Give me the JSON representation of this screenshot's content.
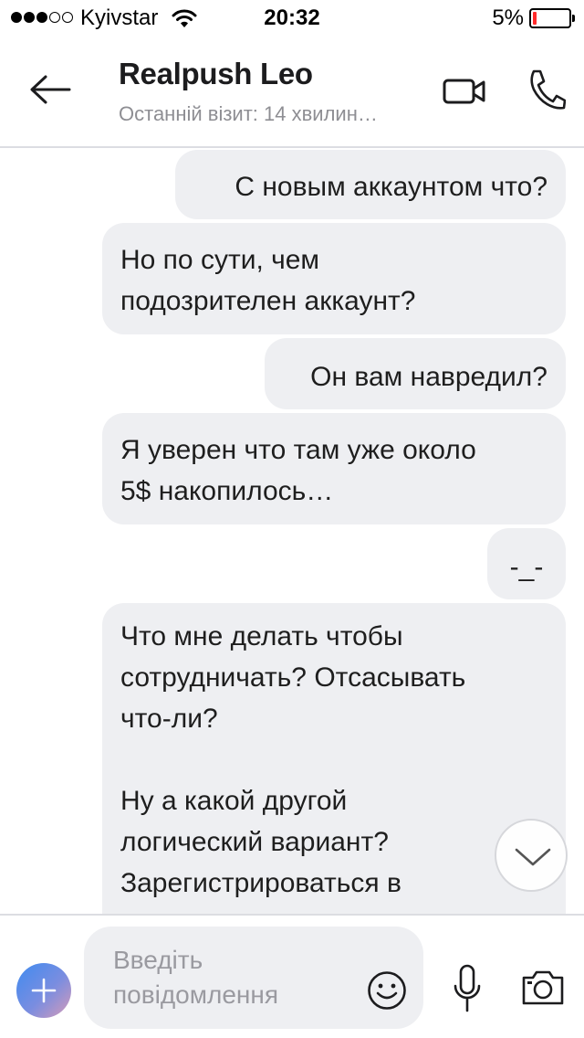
{
  "status_bar": {
    "carrier": "Kyivstar",
    "time": "20:32",
    "battery_percent": "5%",
    "signal_bars_filled": 3,
    "signal_bars_total": 5,
    "battery_level": 0.05,
    "battery_color": "#ff2a2a"
  },
  "header": {
    "contact_name": "Realpush Leo",
    "last_seen": "Останній візит: 14 хвилин…",
    "icons": [
      "back-arrow-icon",
      "video-camera-icon",
      "phone-icon"
    ]
  },
  "messages": [
    {
      "text": "С новым аккаунтом что?"
    },
    {
      "text": "Но по сути, чем\nподозрителен аккаунт?"
    },
    {
      "text": "Он вам навредил?"
    },
    {
      "text": "Я уверен что там уже около\n5$ накопилось…"
    },
    {
      "text": "-_-"
    },
    {
      "text": "Что мне делать чтобы\nсотрудничать? Отсасывать\nчто-ли?\n\nНу а какой другой\nлогический вариант?\nЗарегистрироваться в\nтиндере?"
    }
  ],
  "input": {
    "placeholder": "Введіть повідомлення",
    "icons": [
      "plus-icon",
      "emoji-icon",
      "microphone-icon",
      "camera-icon",
      "chevron-down-icon"
    ]
  },
  "colors": {
    "bubble": "#eeeff2",
    "accent": "#3f8cf0",
    "muted_text": "#8e8e93"
  }
}
